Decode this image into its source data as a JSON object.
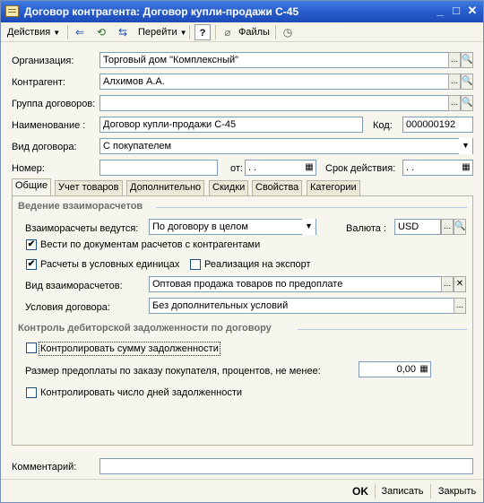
{
  "window": {
    "title": "Договор контрагента: Договор купли-продажи С-45",
    "minimize_glyph": "_",
    "maximize_glyph": "□",
    "close_glyph": "✕"
  },
  "toolbar": {
    "actions_label": "Действия",
    "goto_label": "Перейти",
    "help_label": "?",
    "files_label": "Файлы"
  },
  "form": {
    "organization_label": "Организация:",
    "organization_value": "Торговый дом \"Комплексный\"",
    "counterparty_label": "Контрагент:",
    "counterparty_value": "Алхимов А.А.",
    "contract_group_label": "Группа договоров:",
    "contract_group_value": "",
    "name_label": "Наименование :",
    "name_value": "Договор купли-продажи С-45",
    "code_label": "Код:",
    "code_value": "000000192",
    "contract_type_label": "Вид договора:",
    "contract_type_value": "С покупателем",
    "number_label": "Номер:",
    "number_value": "",
    "from_label": "от:",
    "from_value": " .  .",
    "validity_label": "Срок действия:",
    "validity_value": " .  ."
  },
  "tabs": [
    "Общие",
    "Учет товаров",
    "Дополнительно",
    "Скидки",
    "Свойства",
    "Категории"
  ],
  "general": {
    "section1_title": "Ведение взаиморасчетов",
    "settlements_label": "Взаиморасчеты ведутся:",
    "settlements_value": "По договору в целом",
    "currency_label": "Валюта :",
    "currency_value": "USD",
    "cb_by_documents_label": "Вести по документам расчетов с контрагентами",
    "cb_by_documents_checked": true,
    "cb_conventional_units_label": "Расчеты в условных единицах",
    "cb_conventional_units_checked": true,
    "cb_export_label": "Реализация на экспорт",
    "cb_export_checked": false,
    "settlement_type_label": "Вид взаиморасчетов:",
    "settlement_type_value": "Оптовая продажа товаров по предоплате",
    "terms_label": "Условия договора:",
    "terms_value": "Без дополнительных условий",
    "section2_title": "Контроль дебиторской задолженности по договору",
    "cb_control_amount_label": "Контролировать сумму задолженности",
    "cb_control_amount_checked": false,
    "prepayment_label": "Размер предоплаты по заказу покупателя, процентов, не менее:",
    "prepayment_value": "0,00",
    "cb_control_days_label": "Контролировать число дней задолженности",
    "cb_control_days_checked": false
  },
  "comment": {
    "label": "Комментарий:",
    "value": ""
  },
  "buttons": {
    "ok": "OK",
    "save": "Записать",
    "close": "Закрыть"
  },
  "colors": {
    "title_bar": "#2558c9",
    "window_bg": "#f7f6ee",
    "field_border": "#7f9db9"
  }
}
